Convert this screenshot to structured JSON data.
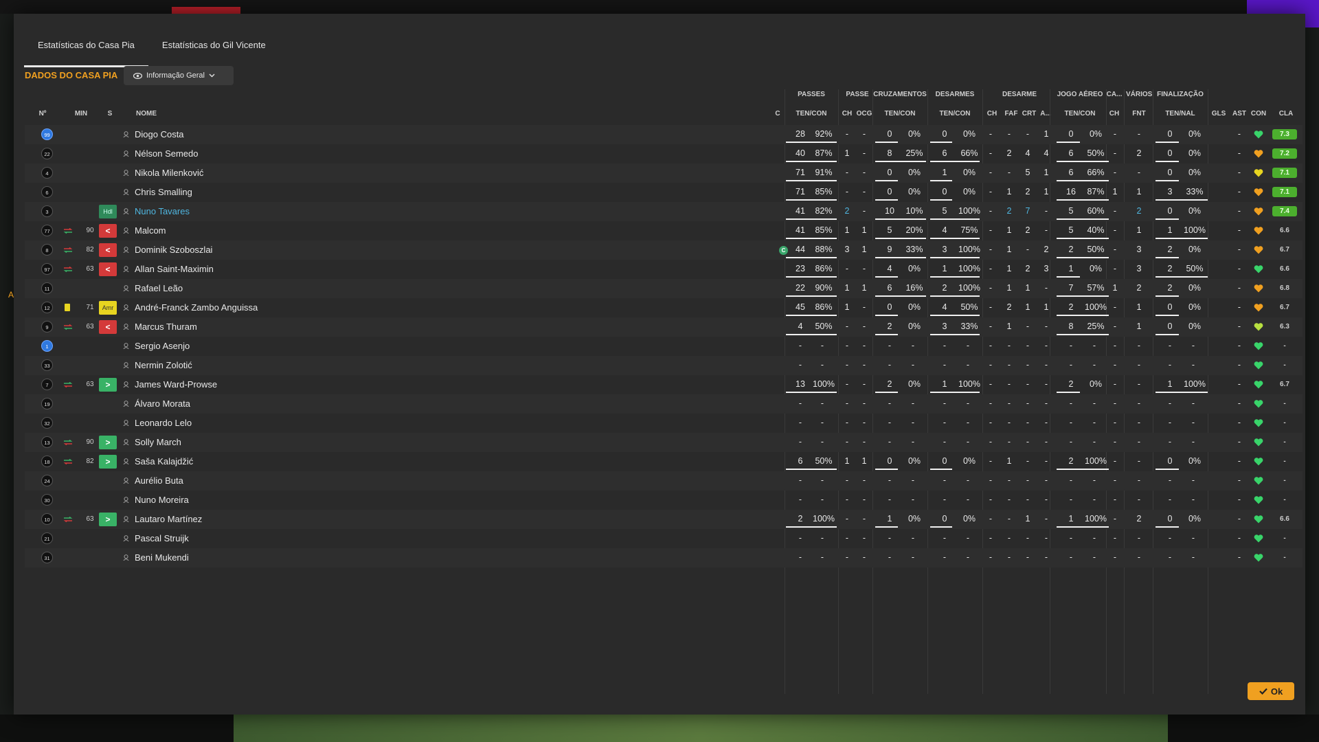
{
  "tabs": [
    "Estatísticas do Casa Pia",
    "Estatísticas do Gil Vicente"
  ],
  "section_title": "DADOS DO CASA PIA",
  "dropdown_label": "Informação Geral",
  "ok_label": "Ok",
  "side_marker": "A",
  "groups": [
    "PASSES",
    "PASSE",
    "CRUZAMENTOS",
    "DESARMES",
    "DESARME",
    "JOGO AÉREO",
    "CA...",
    "VÁRIOS",
    "FINALIZAÇÃO"
  ],
  "headers": [
    "Nº",
    "MIN",
    "S",
    "NOME",
    "C",
    "TEN/CON",
    "CH",
    "OCG",
    "TEN/CON",
    "TEN/CON",
    "CH",
    "FAF",
    "CRT",
    "A...",
    "TEN/CON",
    "CH",
    "FNT",
    "TEN/NAL",
    "GLS",
    "AST",
    "CON",
    "CLA"
  ],
  "players": [
    {
      "num": "99",
      "gk": true,
      "min": "",
      "sub": "",
      "badge": "",
      "badge_text": "",
      "name": "Diogo Costa",
      "pass": [
        "28",
        "92%"
      ],
      "pch": "-",
      "pocg": "-",
      "cruz": [
        "0",
        "0%"
      ],
      "des": [
        "0",
        "0%"
      ],
      "dch": "-",
      "faf": "-",
      "crt": "-",
      "da": "1",
      "aer": [
        "0",
        "0%"
      ],
      "cach": "-",
      "fnt": "-",
      "fin": [
        "0",
        "0%"
      ],
      "gls": "",
      "ast": "-",
      "con": "green",
      "cla": "7.3",
      "cla_good": true,
      "bars": {
        "pass": 0.92,
        "cruz": 0,
        "des": 0,
        "aer": 0,
        "fin": 0
      }
    },
    {
      "num": "22",
      "min": "",
      "sub": "",
      "badge": "",
      "badge_text": "",
      "name": "Nélson Semedo",
      "pass": [
        "40",
        "87%"
      ],
      "pch": "1",
      "pocg": "-",
      "cruz": [
        "8",
        "25%"
      ],
      "des": [
        "6",
        "66%"
      ],
      "dch": "-",
      "faf": "2",
      "crt": "4",
      "da": "4",
      "aer": [
        "6",
        "50%"
      ],
      "cach": "-",
      "fnt": "2",
      "fin": [
        "0",
        "0%"
      ],
      "gls": "",
      "ast": "-",
      "con": "orange",
      "cla": "7.2",
      "cla_good": true,
      "bars": {
        "pass": 0.87,
        "cruz": 0.25,
        "des": 0.66,
        "aer": 0.5,
        "fin": 0
      }
    },
    {
      "num": "4",
      "min": "",
      "sub": "",
      "badge": "",
      "badge_text": "",
      "name": "Nikola Milenković",
      "pass": [
        "71",
        "91%"
      ],
      "pch": "-",
      "pocg": "-",
      "cruz": [
        "0",
        "0%"
      ],
      "des": [
        "1",
        "0%"
      ],
      "dch": "-",
      "faf": "-",
      "crt": "5",
      "da": "1",
      "aer": [
        "6",
        "66%"
      ],
      "cach": "-",
      "fnt": "-",
      "fin": [
        "0",
        "0%"
      ],
      "gls": "",
      "ast": "-",
      "con": "yellow",
      "cla": "7.1",
      "cla_good": true,
      "bars": {
        "pass": 0.91,
        "cruz": 0,
        "des": 0,
        "aer": 0.66,
        "fin": 0
      }
    },
    {
      "num": "6",
      "min": "",
      "sub": "",
      "badge": "",
      "badge_text": "",
      "name": "Chris Smalling",
      "pass": [
        "71",
        "85%"
      ],
      "pch": "-",
      "pocg": "-",
      "cruz": [
        "0",
        "0%"
      ],
      "des": [
        "0",
        "0%"
      ],
      "dch": "-",
      "faf": "1",
      "crt": "2",
      "da": "1",
      "aer": [
        "16",
        "87%"
      ],
      "cach": "1",
      "fnt": "1",
      "fin": [
        "3",
        "33%"
      ],
      "gls": "",
      "ast": "-",
      "con": "orange",
      "cla": "7.1",
      "cla_good": true,
      "bars": {
        "pass": 0.85,
        "cruz": 0,
        "des": 0,
        "aer": 0.87,
        "fin": 0.33
      }
    },
    {
      "num": "3",
      "min": "",
      "sub": "",
      "badge": "hdl",
      "badge_text": "Hdl",
      "name": "Nuno Tavares",
      "link": true,
      "pass": [
        "41",
        "82%"
      ],
      "pch": "2",
      "pocg": "-",
      "cruz": [
        "10",
        "10%"
      ],
      "des": [
        "5",
        "100%"
      ],
      "dch": "-",
      "faf": "2",
      "crt": "7",
      "da": "-",
      "aer": [
        "5",
        "60%"
      ],
      "cach": "-",
      "fnt": "2",
      "fin": [
        "0",
        "0%"
      ],
      "gls": "",
      "ast": "-",
      "con": "orange",
      "cla": "7.4",
      "cla_good": true,
      "bars": {
        "pass": 0.82,
        "cruz": 0.1,
        "des": 1,
        "aer": 0.6,
        "fin": 0
      }
    },
    {
      "num": "77",
      "min": "90",
      "sub": "out",
      "badge": "out",
      "badge_text": "<",
      "name": "Malcom",
      "pass": [
        "41",
        "85%"
      ],
      "pch": "1",
      "pocg": "1",
      "cruz": [
        "5",
        "20%"
      ],
      "des": [
        "4",
        "75%"
      ],
      "dch": "-",
      "faf": "1",
      "crt": "2",
      "da": "-",
      "aer": [
        "5",
        "40%"
      ],
      "cach": "-",
      "fnt": "1",
      "fin": [
        "1",
        "100%"
      ],
      "gls": "",
      "ast": "-",
      "con": "orange",
      "cla": "6.6",
      "bars": {
        "pass": 0.85,
        "cruz": 0.2,
        "des": 0.75,
        "aer": 0.4,
        "fin": 1
      }
    },
    {
      "num": "8",
      "min": "82",
      "sub": "out",
      "badge": "out",
      "badge_text": "<",
      "name": "Dominik Szoboszlai",
      "cap": true,
      "pass": [
        "44",
        "88%"
      ],
      "pch": "3",
      "pocg": "1",
      "cruz": [
        "9",
        "33%"
      ],
      "des": [
        "3",
        "100%"
      ],
      "dch": "-",
      "faf": "1",
      "crt": "-",
      "da": "2",
      "aer": [
        "2",
        "50%"
      ],
      "cach": "-",
      "fnt": "3",
      "fin": [
        "2",
        "0%"
      ],
      "gls": "",
      "ast": "-",
      "con": "orange",
      "cla": "6.7",
      "bars": {
        "pass": 0.88,
        "cruz": 0.33,
        "des": 1,
        "aer": 0.5,
        "fin": 0
      }
    },
    {
      "num": "97",
      "min": "63",
      "sub": "out",
      "badge": "out",
      "badge_text": "<",
      "name": "Allan Saint-Maximin",
      "pass": [
        "23",
        "86%"
      ],
      "pch": "-",
      "pocg": "-",
      "cruz": [
        "4",
        "0%"
      ],
      "des": [
        "1",
        "100%"
      ],
      "dch": "-",
      "faf": "1",
      "crt": "2",
      "da": "3",
      "aer": [
        "1",
        "0%"
      ],
      "cach": "-",
      "fnt": "3",
      "fin": [
        "2",
        "50%"
      ],
      "gls": "",
      "ast": "-",
      "con": "green",
      "cla": "6.6",
      "bars": {
        "pass": 0.86,
        "cruz": 0,
        "des": 1,
        "aer": 0,
        "fin": 0.5
      }
    },
    {
      "num": "11",
      "min": "",
      "sub": "",
      "badge": "",
      "badge_text": "",
      "name": "Rafael Leão",
      "pass": [
        "22",
        "90%"
      ],
      "pch": "1",
      "pocg": "1",
      "cruz": [
        "6",
        "16%"
      ],
      "des": [
        "2",
        "100%"
      ],
      "dch": "-",
      "faf": "1",
      "crt": "1",
      "da": "-",
      "aer": [
        "7",
        "57%"
      ],
      "cach": "1",
      "fnt": "2",
      "fin": [
        "2",
        "0%"
      ],
      "gls": "",
      "ast": "-",
      "con": "orange",
      "cla": "6.8",
      "bars": {
        "pass": 0.9,
        "cruz": 0.16,
        "des": 1,
        "aer": 0.57,
        "fin": 0
      }
    },
    {
      "num": "12",
      "min": "71",
      "sub": "yellow",
      "badge": "amr",
      "badge_text": "Amr",
      "name": "André-Franck Zambo Anguissa",
      "pass": [
        "45",
        "86%"
      ],
      "pch": "1",
      "pocg": "-",
      "cruz": [
        "0",
        "0%"
      ],
      "des": [
        "4",
        "50%"
      ],
      "dch": "-",
      "faf": "2",
      "crt": "1",
      "da": "1",
      "aer": [
        "2",
        "100%"
      ],
      "cach": "-",
      "fnt": "1",
      "fin": [
        "0",
        "0%"
      ],
      "gls": "",
      "ast": "-",
      "con": "orange",
      "cla": "6.7",
      "bars": {
        "pass": 0.86,
        "cruz": 0,
        "des": 0.5,
        "aer": 1,
        "fin": 0
      }
    },
    {
      "num": "9",
      "min": "63",
      "sub": "out",
      "badge": "out",
      "badge_text": "<",
      "name": "Marcus Thuram",
      "pass": [
        "4",
        "50%"
      ],
      "pch": "-",
      "pocg": "-",
      "cruz": [
        "2",
        "0%"
      ],
      "des": [
        "3",
        "33%"
      ],
      "dch": "-",
      "faf": "1",
      "crt": "-",
      "da": "-",
      "aer": [
        "8",
        "25%"
      ],
      "cach": "-",
      "fnt": "1",
      "fin": [
        "0",
        "0%"
      ],
      "gls": "",
      "ast": "-",
      "con": "yellowgreen",
      "cla": "6.3",
      "bars": {
        "pass": 0.5,
        "cruz": 0,
        "des": 0.33,
        "aer": 0.25,
        "fin": 0
      }
    },
    {
      "num": "1",
      "gk": true,
      "min": "",
      "sub": "",
      "badge": "",
      "badge_text": "",
      "name": "Sergio Asenjo",
      "empty": true,
      "con": "green",
      "cla": "-"
    },
    {
      "num": "33",
      "min": "",
      "sub": "",
      "badge": "",
      "badge_text": "",
      "name": "Nermin Zolotić",
      "empty": true,
      "con": "green",
      "cla": "-"
    },
    {
      "num": "7",
      "min": "63",
      "sub": "in",
      "badge": "in",
      "badge_text": ">",
      "name": "James Ward-Prowse",
      "pass": [
        "13",
        "100%"
      ],
      "pch": "-",
      "pocg": "-",
      "cruz": [
        "2",
        "0%"
      ],
      "des": [
        "1",
        "100%"
      ],
      "dch": "-",
      "faf": "-",
      "crt": "-",
      "da": "-",
      "aer": [
        "2",
        "0%"
      ],
      "cach": "-",
      "fnt": "-",
      "fin": [
        "1",
        "100%"
      ],
      "gls": "",
      "ast": "-",
      "con": "green",
      "cla": "6.7",
      "bars": {
        "pass": 1,
        "cruz": 0,
        "des": 1,
        "aer": 0,
        "fin": 1
      }
    },
    {
      "num": "19",
      "min": "",
      "sub": "",
      "badge": "",
      "badge_text": "",
      "name": "Álvaro Morata",
      "empty": true,
      "con": "green",
      "cla": "-"
    },
    {
      "num": "32",
      "min": "",
      "sub": "",
      "badge": "",
      "badge_text": "",
      "name": "Leonardo Lelo",
      "empty": true,
      "con": "green",
      "cla": "-"
    },
    {
      "num": "13",
      "min": "90",
      "sub": "in",
      "badge": "in",
      "badge_text": ">",
      "name": "Solly March",
      "empty": true,
      "con": "green",
      "cla": "-"
    },
    {
      "num": "18",
      "min": "82",
      "sub": "in",
      "badge": "in",
      "badge_text": ">",
      "name": "Saša Kalajdžić",
      "pass": [
        "6",
        "50%"
      ],
      "pch": "1",
      "pocg": "1",
      "cruz": [
        "0",
        "0%"
      ],
      "des": [
        "0",
        "0%"
      ],
      "dch": "-",
      "faf": "1",
      "crt": "-",
      "da": "-",
      "aer": [
        "2",
        "100%"
      ],
      "cach": "-",
      "fnt": "-",
      "fin": [
        "0",
        "0%"
      ],
      "gls": "",
      "ast": "-",
      "con": "green",
      "cla": "-",
      "bars": {
        "pass": 0.5,
        "cruz": 0,
        "des": 0,
        "aer": 1,
        "fin": 0
      }
    },
    {
      "num": "24",
      "min": "",
      "sub": "",
      "badge": "",
      "badge_text": "",
      "name": "Aurélio Buta",
      "empty": true,
      "con": "green",
      "cla": "-"
    },
    {
      "num": "30",
      "min": "",
      "sub": "",
      "badge": "",
      "badge_text": "",
      "name": "Nuno Moreira",
      "empty": true,
      "con": "green",
      "cla": "-"
    },
    {
      "num": "10",
      "min": "63",
      "sub": "in",
      "badge": "in",
      "badge_text": ">",
      "name": "Lautaro Martínez",
      "pass": [
        "2",
        "100%"
      ],
      "pch": "-",
      "pocg": "-",
      "cruz": [
        "1",
        "0%"
      ],
      "des": [
        "0",
        "0%"
      ],
      "dch": "-",
      "faf": "-",
      "crt": "1",
      "da": "-",
      "aer": [
        "1",
        "100%"
      ],
      "cach": "-",
      "fnt": "2",
      "fin": [
        "0",
        "0%"
      ],
      "gls": "",
      "ast": "-",
      "con": "green",
      "cla": "6.6",
      "bars": {
        "pass": 1,
        "cruz": 0,
        "des": 0,
        "aer": 1,
        "fin": 0
      }
    },
    {
      "num": "21",
      "min": "",
      "sub": "",
      "badge": "",
      "badge_text": "",
      "name": "Pascal Struijk",
      "empty": true,
      "con": "green",
      "cla": "-"
    },
    {
      "num": "31",
      "min": "",
      "sub": "",
      "badge": "",
      "badge_text": "",
      "name": "Beni Mukendi",
      "empty": true,
      "con": "green",
      "cla": "-"
    }
  ],
  "colors": {
    "accent": "#f0a020",
    "rating_good": "#4caf2e",
    "sub_out": "#d43a3a",
    "sub_in": "#39b266",
    "heart_green": "#39d46a",
    "heart_orange": "#f0a020",
    "heart_yellow": "#e8d520",
    "heart_yellowgreen": "#b8e040"
  }
}
